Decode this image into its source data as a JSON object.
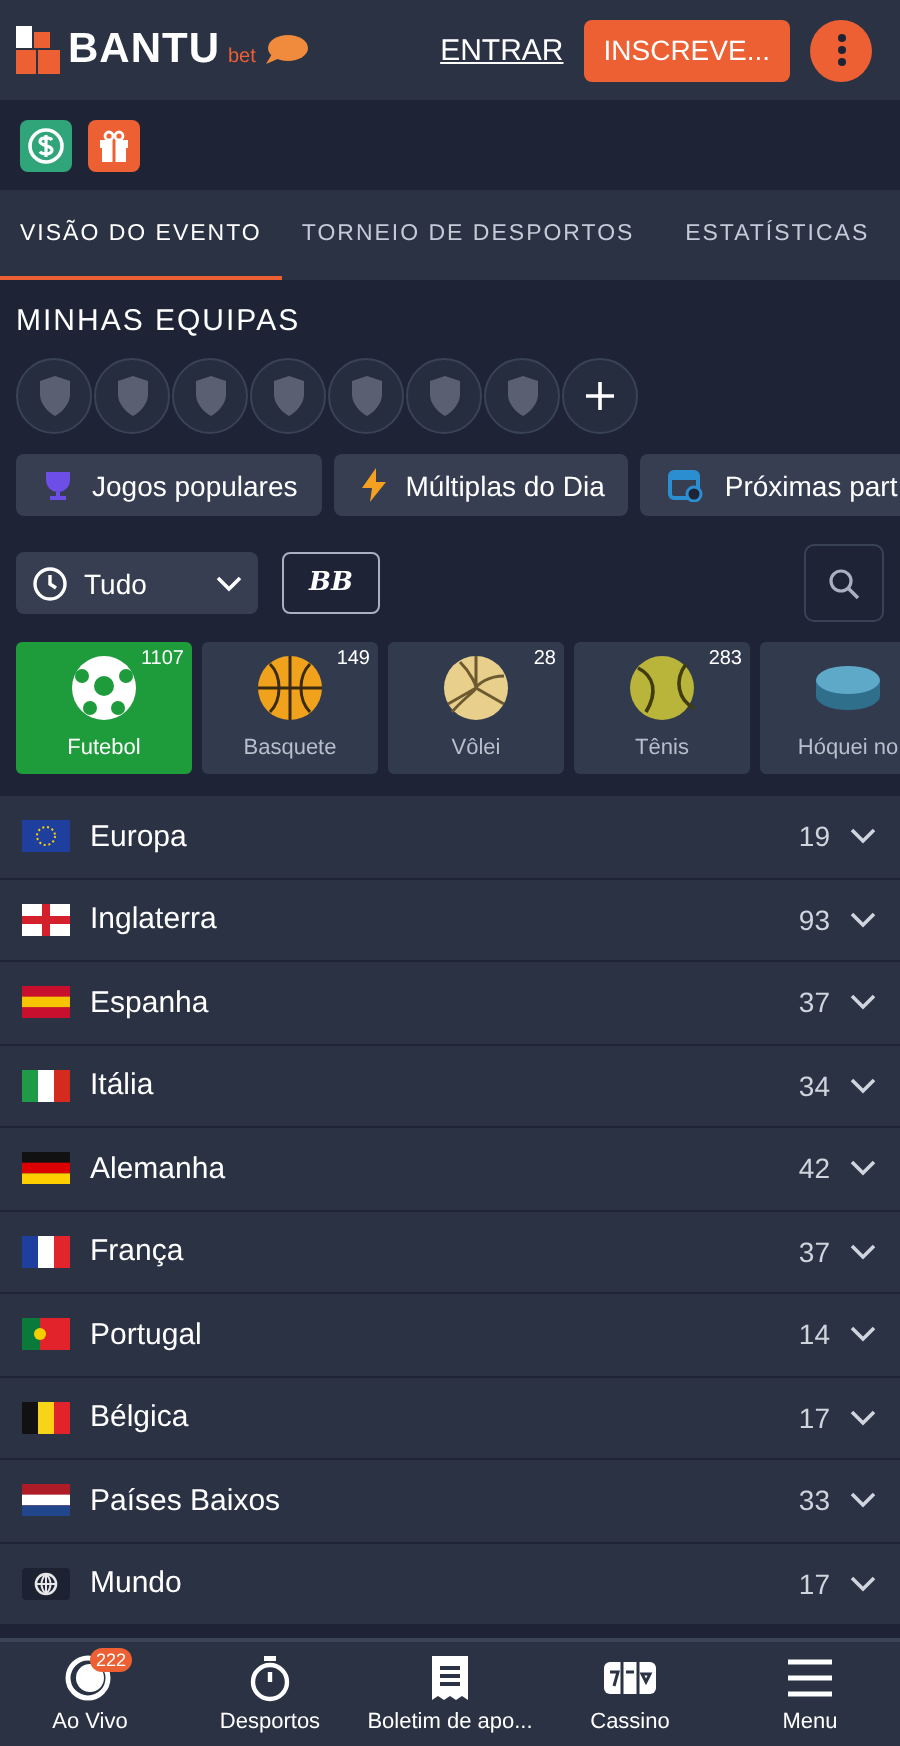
{
  "header": {
    "brand": "BANTU",
    "brand_suffix": "bet",
    "login": "ENTRAR",
    "signup": "INSCREVE..."
  },
  "tabs": [
    {
      "label": "VISÃO DO EVENTO",
      "selected": true
    },
    {
      "label": "TORNEIO DE DESPORTOS",
      "selected": false
    },
    {
      "label": "ESTATÍSTICAS",
      "selected": false
    }
  ],
  "my_teams": {
    "title": "MINHAS EQUIPAS",
    "slots": [
      {
        "kind": "empty"
      },
      {
        "kind": "empty"
      },
      {
        "kind": "empty"
      },
      {
        "kind": "empty"
      },
      {
        "kind": "empty"
      },
      {
        "kind": "empty"
      },
      {
        "kind": "empty"
      },
      {
        "kind": "add"
      }
    ]
  },
  "chips": [
    {
      "label": "Jogos populares",
      "kind": "trophy"
    },
    {
      "label": "Múltiplas do Dia",
      "kind": "bolt"
    },
    {
      "label": "Próximas part",
      "kind": "calendar"
    }
  ],
  "filter": {
    "period": "Tudo",
    "bb": "BB"
  },
  "sports": [
    {
      "name": "Futebol",
      "count": "1107",
      "kind": "football",
      "selected": true
    },
    {
      "name": "Basquete",
      "count": "149",
      "kind": "basketball",
      "selected": false
    },
    {
      "name": "Vôlei",
      "count": "28",
      "kind": "volleyball",
      "selected": false
    },
    {
      "name": "Tênis",
      "count": "283",
      "kind": "tennis",
      "selected": false
    },
    {
      "name": "Hóquei no",
      "kind": "hockey",
      "selected": false
    }
  ],
  "regions": [
    {
      "name": "Europa",
      "count": "19",
      "kind": "eu"
    },
    {
      "name": "Inglaterra",
      "count": "93",
      "kind": "england"
    },
    {
      "name": "Espanha",
      "count": "37",
      "kind": "spain"
    },
    {
      "name": "Itália",
      "count": "34",
      "kind": "italy"
    },
    {
      "name": "Alemanha",
      "count": "42",
      "kind": "germany"
    },
    {
      "name": "França",
      "count": "37",
      "kind": "france"
    },
    {
      "name": "Portugal",
      "count": "14",
      "kind": "portugal"
    },
    {
      "name": "Bélgica",
      "count": "17",
      "kind": "belgium"
    },
    {
      "name": "Países Baixos",
      "count": "33",
      "kind": "netherlands"
    },
    {
      "name": "Mundo",
      "count": "17",
      "kind": "world"
    }
  ],
  "nav": [
    {
      "label": "Ao Vivo",
      "kind": "live",
      "badge": "222"
    },
    {
      "label": "Desportos",
      "kind": "stopwatch"
    },
    {
      "label": "Boletim de apo...",
      "kind": "slip"
    },
    {
      "label": "Cassino",
      "kind": "slots"
    },
    {
      "label": "Menu",
      "kind": "menu"
    }
  ]
}
